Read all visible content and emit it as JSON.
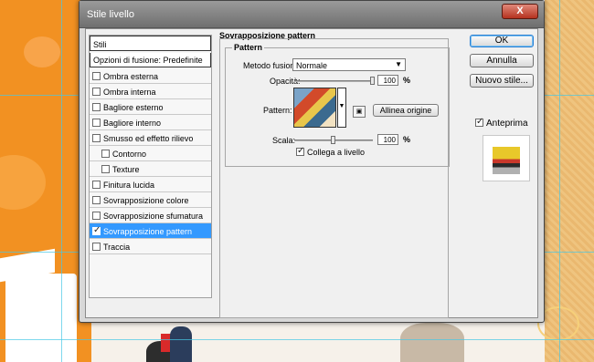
{
  "dialog": {
    "title": "Stile livello",
    "close_glyph": "X"
  },
  "style_list": {
    "header": "Stili",
    "blending_options": "Opzioni di fusione: Predefinite",
    "items": [
      {
        "label": "Ombra esterna",
        "checked": false,
        "selected": false,
        "sub": false
      },
      {
        "label": "Ombra interna",
        "checked": false,
        "selected": false,
        "sub": false
      },
      {
        "label": "Bagliore esterno",
        "checked": false,
        "selected": false,
        "sub": false
      },
      {
        "label": "Bagliore interno",
        "checked": false,
        "selected": false,
        "sub": false
      },
      {
        "label": "Smusso ed effetto rilievo",
        "checked": false,
        "selected": false,
        "sub": false
      },
      {
        "label": "Contorno",
        "checked": false,
        "selected": false,
        "sub": true
      },
      {
        "label": "Texture",
        "checked": false,
        "selected": false,
        "sub": true
      },
      {
        "label": "Finitura lucida",
        "checked": false,
        "selected": false,
        "sub": false
      },
      {
        "label": "Sovrapposizione colore",
        "checked": false,
        "selected": false,
        "sub": false
      },
      {
        "label": "Sovrapposizione sfumatura",
        "checked": false,
        "selected": false,
        "sub": false
      },
      {
        "label": "Sovrapposizione pattern",
        "checked": true,
        "selected": true,
        "sub": false
      },
      {
        "label": "Traccia",
        "checked": false,
        "selected": false,
        "sub": false
      }
    ]
  },
  "pattern_overlay": {
    "section_title": "Sovrapposizione pattern",
    "group_title": "Pattern",
    "blend_mode_label": "Metodo fusione:",
    "blend_mode_value": "Normale",
    "opacity_label": "Opacità:",
    "opacity_value": "100",
    "opacity_level": 1.0,
    "opacity_unit": "%",
    "pattern_label": "Pattern:",
    "snap_button": "Allinea origine",
    "scale_label": "Scala:",
    "scale_value": "100",
    "scale_level": 0.5,
    "scale_unit": "%",
    "link_label": "Collega a livello",
    "link_checked": true
  },
  "buttons": {
    "ok": "OK",
    "cancel": "Annulla",
    "new_style": "Nuovo stile..."
  },
  "preview": {
    "label": "Anteprima",
    "checked": true
  },
  "colors": {
    "selection": "#3399ff",
    "canvas_orange": "#f29122",
    "guide": "#47c7e6"
  }
}
